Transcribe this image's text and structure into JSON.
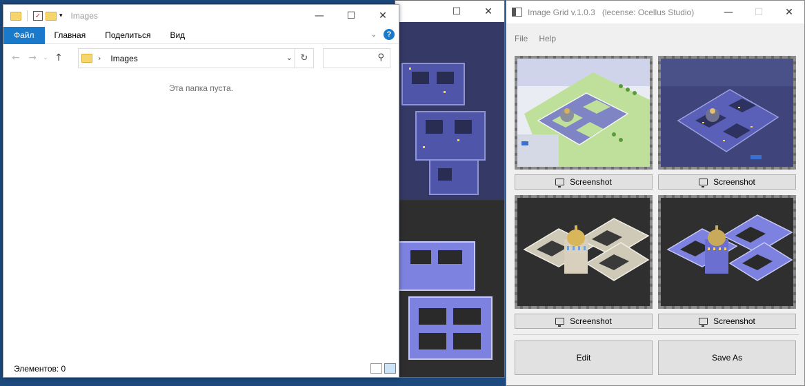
{
  "explorer": {
    "window_title": "Images",
    "ribbon_tabs": [
      "Файл",
      "Главная",
      "Поделиться",
      "Вид"
    ],
    "help_label": "?",
    "address_path": "Images",
    "search_placeholder": "",
    "empty_message": "Эта папка пуста.",
    "status_text": "Элементов: 0"
  },
  "image_grid": {
    "window_title": "Image Grid v.1.0.3   (lecense: Ocellus Studio)",
    "menu": [
      "File",
      "Help"
    ],
    "screenshot_buttons": [
      "Screenshot",
      "Screenshot",
      "Screenshot",
      "Screenshot"
    ],
    "edit_label": "Edit",
    "save_as_label": "Save As"
  },
  "icons": {
    "folder": "folder-icon",
    "properties": "checkbox-icon",
    "back": "arrow-left-icon",
    "forward": "arrow-right-icon",
    "up": "arrow-up-icon",
    "refresh": "refresh-icon",
    "search": "search-icon",
    "screenshot": "monitor-icon"
  },
  "colors": {
    "file_tab": "#1979ca",
    "desktop": "#1c4a7e",
    "building": "#4f55a8"
  }
}
